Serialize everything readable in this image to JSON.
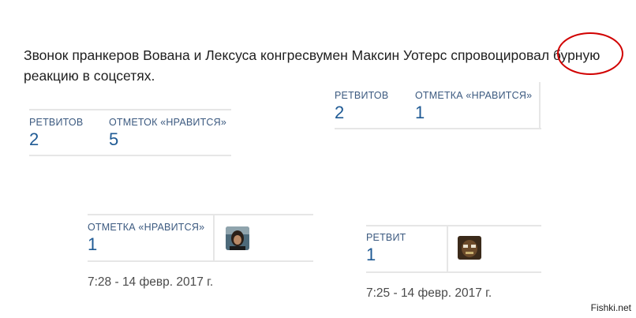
{
  "article": {
    "headline": "Звонок пранкеров Вована и Лексуса конгресвумен Максин Уотерс спровоцировал бурную реакцию в соцсетях."
  },
  "tweet_stats_1": {
    "retweets_label": "РЕТВИТОВ",
    "retweets_value": "2",
    "likes_label": "ОТМЕТОК «НРАВИТСЯ»",
    "likes_value": "5"
  },
  "tweet_stats_2": {
    "retweets_label": "РЕТВИТОВ",
    "retweets_value": "2",
    "likes_label": "ОТМЕТКА «НРАВИТСЯ»",
    "likes_value": "1"
  },
  "tweet_stats_3": {
    "likes_label": "ОТМЕТКА «НРАВИТСЯ»",
    "likes_value": "1",
    "timestamp": "7:28 - 14 февр. 2017 г."
  },
  "tweet_stats_4": {
    "retweet_label": "РЕТВИТ",
    "retweet_value": "1",
    "timestamp": "7:25 - 14 февр. 2017 г."
  },
  "watermark": "Fishki.net",
  "colors": {
    "highlight_circle": "#d10000",
    "stat_number": "#1f5a94",
    "stat_label": "#3c5a80"
  }
}
